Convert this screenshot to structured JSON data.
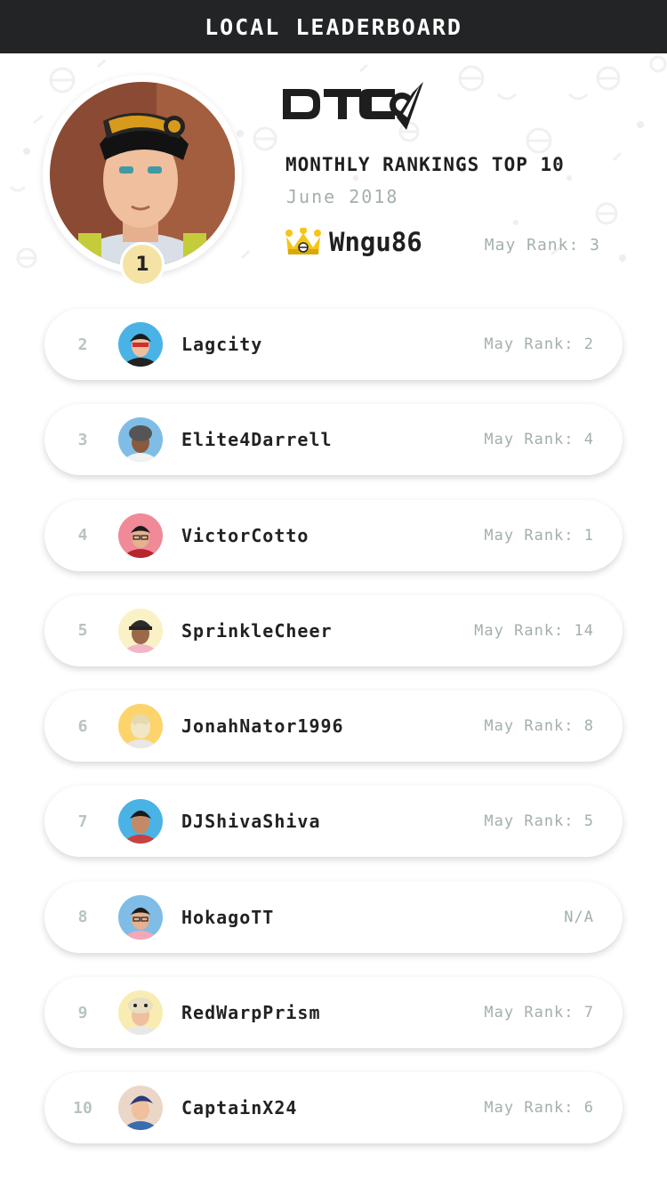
{
  "header": {
    "title": "LOCAL LEADERBOARD"
  },
  "brand": {
    "logo_text": "DTC",
    "logo_icon": "pokeball-swoosh-icon",
    "color": "#1e1e1e"
  },
  "summary": {
    "title": "MONTHLY RANKINGS TOP 10",
    "period": "June 2018"
  },
  "winner": {
    "rank": "1",
    "name": "Wngu86",
    "prev_rank": "May Rank: 3",
    "crown_icon": "crown-icon",
    "badge_color": "#f4e3a4"
  },
  "rankings": [
    {
      "rank": "2",
      "name": "Lagcity",
      "prev_rank": "May Rank: 2",
      "avatar_bg": "#4ab3e6"
    },
    {
      "rank": "3",
      "name": "Elite4Darrell",
      "prev_rank": "May Rank: 4",
      "avatar_bg": "#7fbde6"
    },
    {
      "rank": "4",
      "name": "VictorCotto",
      "prev_rank": "May Rank: 1",
      "avatar_bg": "#f08a98"
    },
    {
      "rank": "5",
      "name": "SprinkleCheer",
      "prev_rank": "May Rank: 14",
      "avatar_bg": "#fbf1c6"
    },
    {
      "rank": "6",
      "name": "JonahNator1996",
      "prev_rank": "May Rank: 8",
      "avatar_bg": "#fcd46b"
    },
    {
      "rank": "7",
      "name": "DJShivaShiva",
      "prev_rank": "May Rank: 5",
      "avatar_bg": "#4ab3e6"
    },
    {
      "rank": "8",
      "name": "HokagoTT",
      "prev_rank": "N/A",
      "avatar_bg": "#7fbde6"
    },
    {
      "rank": "9",
      "name": "RedWarpPrism",
      "prev_rank": "May Rank: 7",
      "avatar_bg": "#f9ecb2"
    },
    {
      "rank": "10",
      "name": "CaptainX24",
      "prev_rank": "May Rank: 6",
      "avatar_bg": "#ead7c8"
    }
  ],
  "colors": {
    "topbar": "#222425",
    "muted_text": "#a3b0ab",
    "rank_text": "#b8c4bf",
    "text": "#222222"
  }
}
